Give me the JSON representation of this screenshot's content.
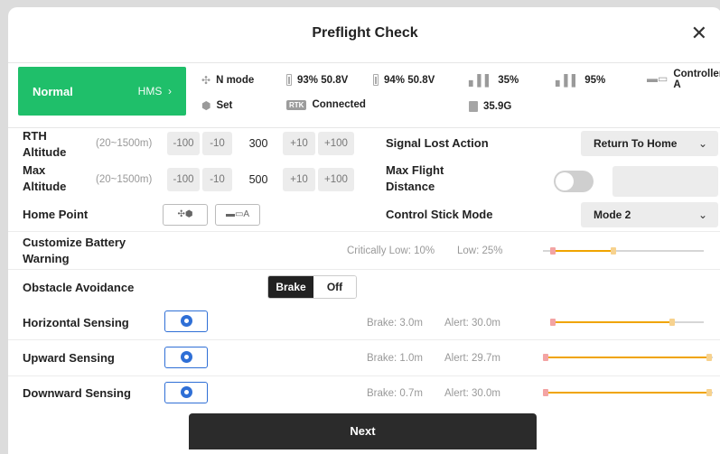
{
  "header": {
    "title": "Preflight Check",
    "close_glyph": "✕"
  },
  "status": {
    "mode_label": "Normal",
    "hms_label": "HMS",
    "hms_glyph": "›",
    "flight_mode": "N mode",
    "home_label": "Set",
    "aircraft_battery": "93% 50.8V",
    "rc_battery": "94% 50.8V",
    "rtk_label": "RTK",
    "rtk_status": "Connected",
    "signal_1": "35%",
    "signal_2": "95%",
    "storage": "35.9G",
    "controller": "Controller",
    "controller_sub": "A"
  },
  "rth": {
    "label_line1": "RTH",
    "label_line2": "Altitude",
    "range": "(20~1500m)",
    "minus100": "-100",
    "minus10": "-10",
    "value": "300",
    "plus10": "+10",
    "plus100": "+100"
  },
  "max_alt": {
    "label_line1": "Max",
    "label_line2": "Altitude",
    "range": "(20~1500m)",
    "minus100": "-100",
    "minus10": "-10",
    "value": "500",
    "plus10": "+10",
    "plus100": "+100"
  },
  "signal_lost": {
    "label": "Signal Lost Action",
    "value": "Return To Home"
  },
  "max_flight": {
    "label_line1": "Max Flight",
    "label_line2": "Distance",
    "enabled": false
  },
  "home_point": {
    "label": "Home Point",
    "btn_aircraft": "✣⬢",
    "btn_rc": "A"
  },
  "stick_mode": {
    "label": "Control Stick Mode",
    "value": "Mode 2"
  },
  "battery_warning": {
    "label_line1": "Customize Battery",
    "label_line2": "Warning",
    "critical": "Critically Low: 10%",
    "low": "Low: 25%",
    "critical_value": 10,
    "low_value": 25
  },
  "obstacle": {
    "label": "Obstacle Avoidance",
    "brake": "Brake",
    "off": "Off"
  },
  "sensing": [
    {
      "label": "Horizontal Sensing",
      "brake": "Brake: 3.0m",
      "alert": "Alert: 30.0m"
    },
    {
      "label": "Upward Sensing",
      "brake": "Brake: 1.0m",
      "alert": "Alert: 29.7m"
    },
    {
      "label": "Downward Sensing",
      "brake": "Brake: 0.7m",
      "alert": "Alert: 30.0m"
    }
  ],
  "footer": {
    "next": "Next"
  },
  "colors": {
    "accent_green": "#1fbf6a",
    "slider_orange": "#f0a400",
    "sensor_blue": "#2f6fd6"
  }
}
